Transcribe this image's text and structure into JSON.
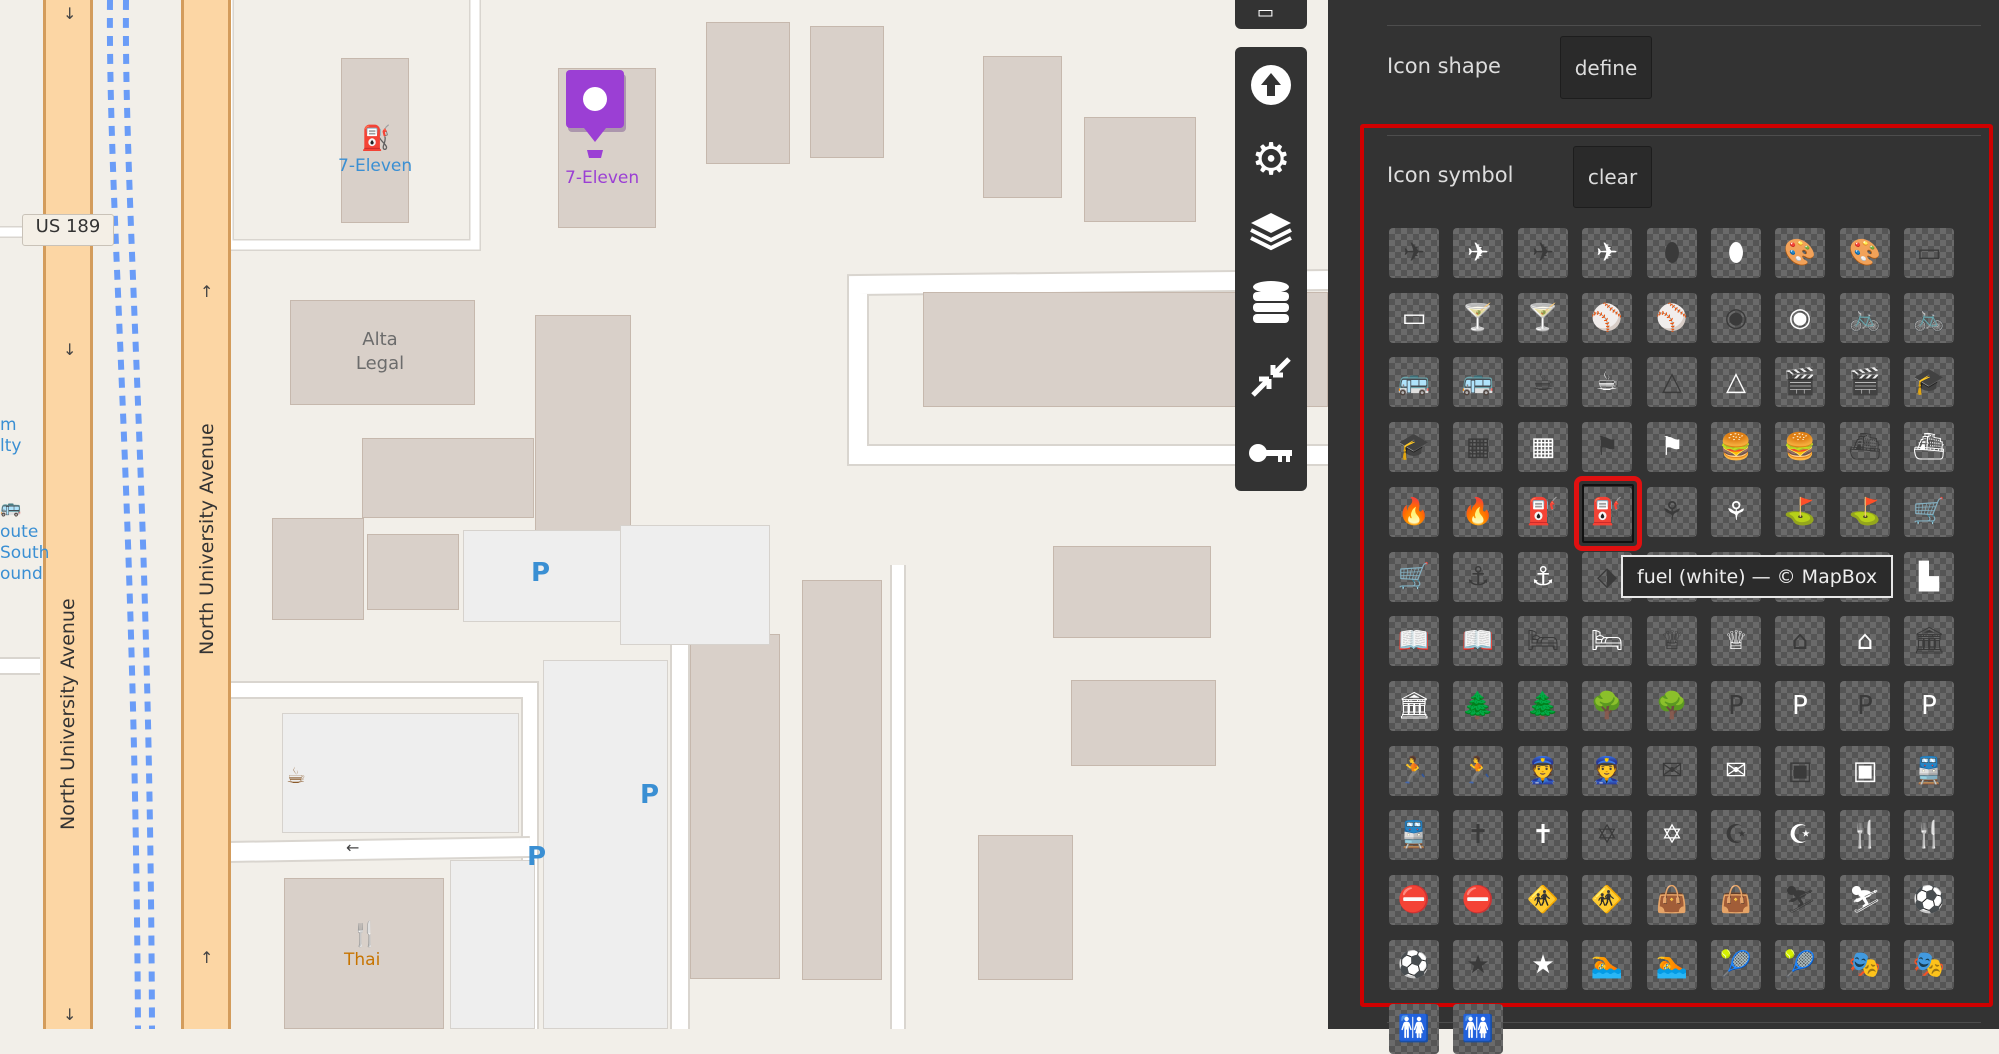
{
  "map": {
    "labels": {
      "seven_eleven_1": "7-Eleven",
      "seven_eleven_2": "7-Eleven",
      "alta_legal": "Alta\nLegal",
      "us189": "US 189",
      "thai": "Thai",
      "left_partial_1": "m\nlty",
      "left_partial_2": "oute\nSouth\nound",
      "north_university_1": "North University Avenue",
      "north_university_2": "North University Avenue"
    },
    "parking_label": "P",
    "colors": {
      "background": "#f2efe9",
      "building": "#d9d0c9",
      "road_major": "#fcd6a4",
      "road_casing": "#d39c5c",
      "rail": "#6a9cf7",
      "marker": "#9b3fd4",
      "poi_blue": "#3a8fd3",
      "food": "#c77400"
    }
  },
  "toolbar": {
    "buttons": [
      {
        "name": "upload-icon"
      },
      {
        "name": "gear-icon"
      },
      {
        "name": "layers-icon"
      },
      {
        "name": "database-icon"
      },
      {
        "name": "collapse-icon"
      },
      {
        "name": "key-icon"
      }
    ]
  },
  "panel": {
    "icon_shape": {
      "title": "Icon shape",
      "button": "define"
    },
    "icon_symbol": {
      "title": "Icon symbol",
      "button": "clear"
    },
    "tooltip": "fuel (white) — © MapBox",
    "symbols": [
      {
        "name": "airfield",
        "glyph": "✈"
      },
      {
        "name": "airport",
        "glyph": "✈"
      },
      {
        "name": "american-football",
        "glyph": "⬮"
      },
      {
        "name": "art-gallery",
        "glyph": "🎨"
      },
      {
        "name": "bank",
        "glyph": "▭"
      },
      {
        "name": "bar",
        "glyph": "🍸"
      },
      {
        "name": "baseball",
        "glyph": "⚾"
      },
      {
        "name": "basketball",
        "glyph": "◉"
      },
      {
        "name": "bicycle",
        "glyph": "🚲"
      },
      {
        "name": "bus",
        "glyph": "🚌"
      },
      {
        "name": "cafe",
        "glyph": "☕"
      },
      {
        "name": "campsite",
        "glyph": "△"
      },
      {
        "name": "cinema",
        "glyph": "🎬"
      },
      {
        "name": "college",
        "glyph": "🎓"
      },
      {
        "name": "commercial",
        "glyph": "▦"
      },
      {
        "name": "cricket",
        "glyph": "⚑"
      },
      {
        "name": "fast-food",
        "glyph": "🍔"
      },
      {
        "name": "ferry",
        "glyph": "⛴"
      },
      {
        "name": "fire-station",
        "glyph": "🔥"
      },
      {
        "name": "fuel",
        "glyph": "⛽"
      },
      {
        "name": "garden",
        "glyph": "⚘"
      },
      {
        "name": "golf",
        "glyph": "⛳"
      },
      {
        "name": "grocery",
        "glyph": "🛒"
      },
      {
        "name": "harbor",
        "glyph": "⚓"
      },
      {
        "name": "heliport",
        "glyph": "⬗"
      },
      {
        "name": "hospital",
        "glyph": "✚"
      },
      {
        "name": "industrial",
        "glyph": "▙"
      },
      {
        "name": "library",
        "glyph": "📖"
      },
      {
        "name": "lodging",
        "glyph": "🛏"
      },
      {
        "name": "london-underground",
        "glyph": "♕"
      },
      {
        "name": "monument",
        "glyph": "⌂"
      },
      {
        "name": "museum",
        "glyph": "🏛"
      },
      {
        "name": "park",
        "glyph": "🌲"
      },
      {
        "name": "park2",
        "glyph": "🌳"
      },
      {
        "name": "parking",
        "glyph": "P"
      },
      {
        "name": "parking-garage",
        "glyph": "P"
      },
      {
        "name": "pitch",
        "glyph": "🏃"
      },
      {
        "name": "police",
        "glyph": "👮"
      },
      {
        "name": "post",
        "glyph": "✉"
      },
      {
        "name": "prison",
        "glyph": "▣"
      },
      {
        "name": "rail",
        "glyph": "🚆"
      },
      {
        "name": "religious-christian",
        "glyph": "✝"
      },
      {
        "name": "religious-jewish",
        "glyph": "✡"
      },
      {
        "name": "religious-muslim",
        "glyph": "☪"
      },
      {
        "name": "restaurant",
        "glyph": "🍴"
      },
      {
        "name": "roadblock",
        "glyph": "⛔"
      },
      {
        "name": "school",
        "glyph": "🚸"
      },
      {
        "name": "shop",
        "glyph": "👜"
      },
      {
        "name": "skiing",
        "glyph": "⛷"
      },
      {
        "name": "soccer",
        "glyph": "⚽"
      },
      {
        "name": "star",
        "glyph": "★"
      },
      {
        "name": "swimming",
        "glyph": "🏊"
      },
      {
        "name": "tennis",
        "glyph": "🎾"
      },
      {
        "name": "theatre",
        "glyph": "🎭"
      },
      {
        "name": "toilets",
        "glyph": "🚻"
      }
    ]
  }
}
